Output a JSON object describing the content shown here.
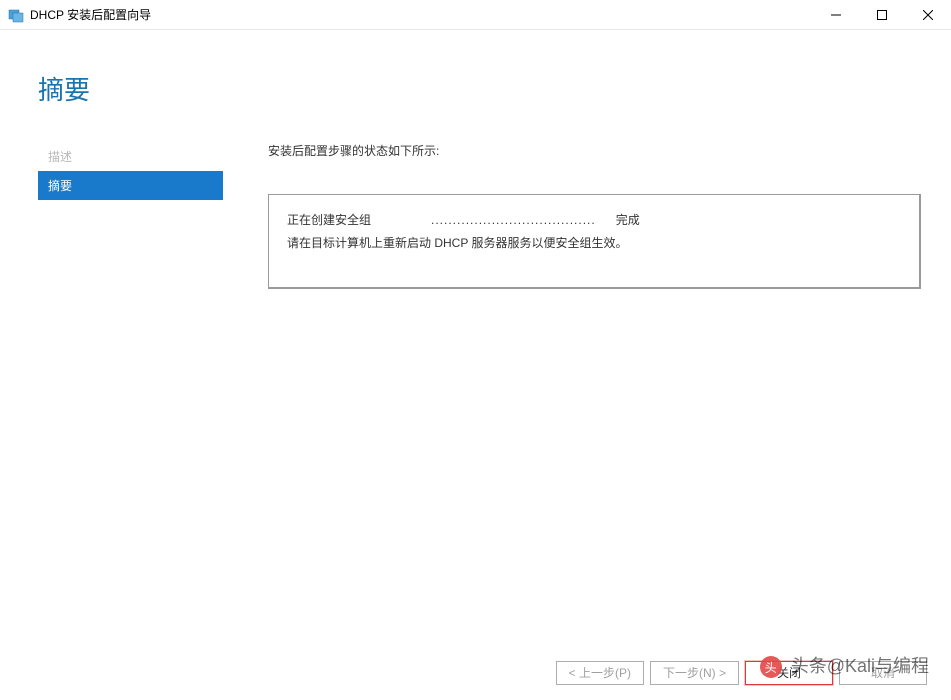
{
  "titlebar": {
    "title": "DHCP 安装后配置向导"
  },
  "header": {
    "page_title": "摘要"
  },
  "sidebar": {
    "items": [
      {
        "label": "描述",
        "state": "disabled"
      },
      {
        "label": "摘要",
        "state": "active"
      }
    ]
  },
  "main": {
    "intro": "安装后配置步骤的状态如下所示:",
    "status": {
      "task_label": "正在创建安全组",
      "dots": "......................................",
      "result": "完成",
      "note": "请在目标计算机上重新启动 DHCP 服务器服务以便安全组生效。"
    }
  },
  "footer": {
    "prev": "< 上一步(P)",
    "next": "下一步(N) >",
    "close": "关闭",
    "cancel": "取消"
  },
  "watermark": {
    "text": "头条@Kali与编程"
  }
}
